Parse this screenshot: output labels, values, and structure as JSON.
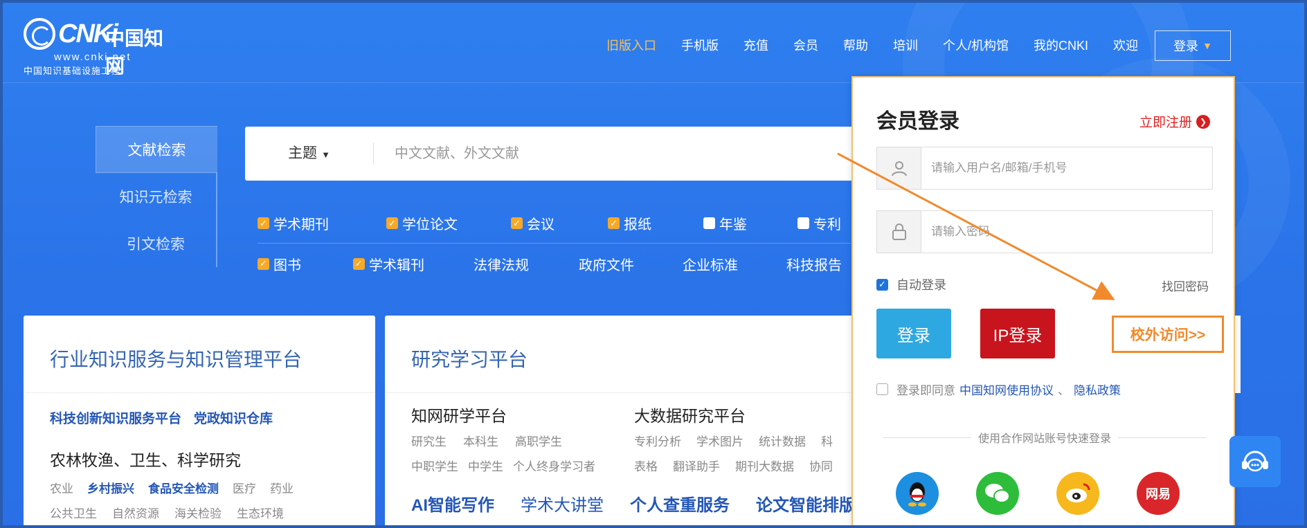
{
  "logo": {
    "cnki": "CNKi",
    "cn_name": "中国知网",
    "url": "www.cnki.net",
    "subtitle": "中国知识基础设施工程"
  },
  "topnav": {
    "items": [
      "旧版入口",
      "手机版",
      "充值",
      "会员",
      "帮助",
      "培训",
      "个人/机构馆",
      "我的CNKI",
      "欢迎"
    ],
    "login_label": "登录"
  },
  "search": {
    "tabs": [
      "文献检索",
      "知识元检索",
      "引文检索"
    ],
    "field_label": "主题",
    "placeholder": "中文文献、外文文献",
    "filters_row1": [
      {
        "label": "学术期刊",
        "checked": true
      },
      {
        "label": "学位论文",
        "checked": true
      },
      {
        "label": "会议",
        "checked": true
      },
      {
        "label": "报纸",
        "checked": true
      },
      {
        "label": "年鉴",
        "checked": false
      },
      {
        "label": "专利",
        "checked": false
      }
    ],
    "filters_row2": [
      {
        "label": "图书",
        "checked": true
      },
      {
        "label": "学术辑刊",
        "checked": true
      },
      {
        "label": "法律法规",
        "checked": null
      },
      {
        "label": "政府文件",
        "checked": null
      },
      {
        "label": "企业标准",
        "checked": null
      },
      {
        "label": "科技报告",
        "checked": null
      }
    ]
  },
  "card_left": {
    "title": "行业知识服务与知识管理平台",
    "links": [
      "科技创新知识服务平台",
      "党政知识仓库"
    ],
    "section": "农林牧渔、卫生、科学研究",
    "row1": [
      "农业",
      "乡村振兴",
      "食品安全检测",
      "医疗",
      "药业"
    ],
    "row1_bold": [
      false,
      true,
      true,
      false,
      false
    ],
    "row2": [
      "公共卫生",
      "自然资源",
      "海关检验",
      "生态环境"
    ]
  },
  "card_mid": {
    "title": "研究学习平台",
    "col1_head": "知网研学平台",
    "col1_row1": [
      "研究生",
      "本科生",
      "高职学生"
    ],
    "col1_row2": [
      "中职学生",
      "中学生",
      "个人终身学习者"
    ],
    "col2_head": "大数据研究平台",
    "col2_row1": [
      "专利分析",
      "学术图片",
      "统计数据",
      "科"
    ],
    "col2_row2": [
      "表格",
      "翻译助手",
      "期刊大数据",
      "协同"
    ],
    "bottom_links": [
      "AI智能写作",
      "学术大讲堂",
      "个人查重服务",
      "论文智能排版"
    ]
  },
  "login_panel": {
    "title": "会员登录",
    "register": "立即注册",
    "username_placeholder": "请输入用户名/邮箱/手机号",
    "password_placeholder": "请输入密码",
    "auto_login": "自动登录",
    "forgot": "找回密码",
    "login_btn": "登录",
    "ip_login_btn": "IP登录",
    "off_campus": "校外访问>>",
    "agree_prefix": "登录即同意",
    "agree_link1": "中国知网使用协议",
    "agree_sep": "、",
    "agree_link2": "隐私政策",
    "partner_text": "使用合作网站账号快速登录",
    "socials": [
      {
        "name": "qq",
        "color": "#1c8fe0",
        "label": ""
      },
      {
        "name": "wechat",
        "color": "#2dbd3a",
        "label": ""
      },
      {
        "name": "weibo",
        "color": "#f6b81c",
        "label": ""
      },
      {
        "name": "netease",
        "color": "#d9262a",
        "label": "网易"
      }
    ]
  },
  "colors": {
    "accent_orange": "#f08a2c",
    "brand_blue": "#2a73e8",
    "ip_red": "#c8141c",
    "login_blue": "#2ea8e0"
  }
}
